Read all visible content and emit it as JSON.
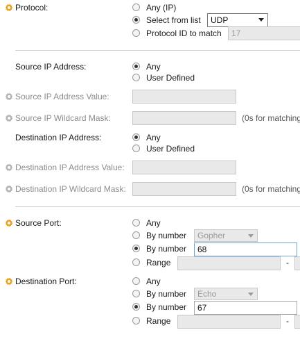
{
  "protocol": {
    "label": "Protocol:",
    "options": [
      "Any (IP)",
      "Select from list",
      "Protocol ID to match"
    ],
    "selected_index": 1,
    "list_value": "UDP",
    "id_value": "17"
  },
  "source_ip": {
    "label": "Source IP Address:",
    "options": [
      "Any",
      "User Defined"
    ],
    "selected_index": 0,
    "value_label": "Source IP Address Value:",
    "mask_label": "Source IP Wildcard Mask:",
    "mask_note": "(0s for matching"
  },
  "dest_ip": {
    "label": "Destination IP Address:",
    "options": [
      "Any",
      "User Defined"
    ],
    "selected_index": 0,
    "value_label": "Destination IP Address Value:",
    "mask_label": "Destination IP Wildcard Mask:",
    "mask_note": "(0s for matching"
  },
  "source_port": {
    "label": "Source Port:",
    "options": [
      "Any",
      "By number",
      "By number",
      "Range"
    ],
    "selected_index": 2,
    "list_value": "Gopher",
    "number_value": "68",
    "range_sep": "-"
  },
  "dest_port": {
    "label": "Destination Port:",
    "options": [
      "Any",
      "By number",
      "By number",
      "Range"
    ],
    "selected_index": 2,
    "list_value": "Echo",
    "number_value": "67",
    "range_sep": "-"
  },
  "colors": {
    "required_icon": "#f0a020",
    "optional_icon": "#b5b5b5"
  }
}
